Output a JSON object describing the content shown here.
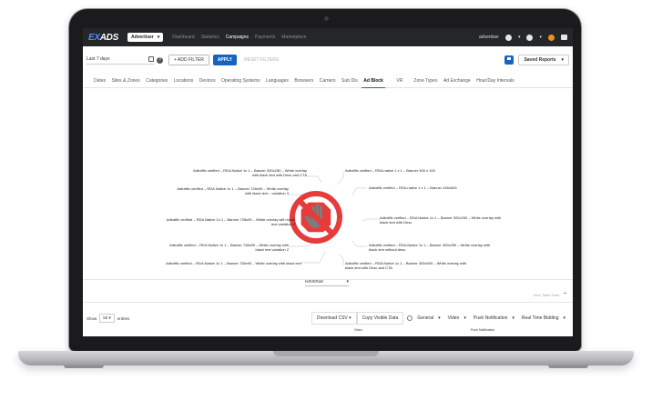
{
  "topnav": {
    "logo_prefix": "EX",
    "logo_suffix": "ADS",
    "account_select": "Advertiser",
    "links": [
      "Dashboard",
      "Statistics",
      "Campaigns",
      "Payments",
      "Marketplace"
    ],
    "active_link": "Campaigns",
    "user": "advertiser"
  },
  "filterbar": {
    "period": "Last 7 days",
    "add_filter": "+ ADD FILTER",
    "apply": "APPLY",
    "reset": "RESET FILTERS",
    "saved_reports": "Saved Reports"
  },
  "tabs": [
    "Dates",
    "Sites & Zones",
    "Categories",
    "Locations",
    "Devices",
    "Operating Systems",
    "Languages",
    "Browsers",
    "Carriers",
    "Sub IDs",
    "Ad Block",
    "VR",
    "Zone Types",
    "Ad Exchange",
    "Hour/Day Intervals"
  ],
  "active_tab": "Ad Block",
  "chart": {
    "labels_left": [
      "Adtraffic verified – RDA Native 1x 1 – Banner 300x250 – White overlay with black text with Desc and CTA",
      "Adtraffic verified – RDA Native 1x 1 – Banner 728x90 – White overlay with black text – variation 3",
      "Adtraffic verified – RDA Native 1x 1 – Banner 728x90 – White overlay with black text variation 4",
      "Adtraffic verified – RDA Native 1x 1 – Banner 728x90 – White overlay with black text variation 2",
      "Adtraffic verified – RDA Native 1x 1 – Banner 728x90 – White overlay with black text"
    ],
    "labels_right": [
      "Adtraffic verified – RDA native 1 x 1 – Banner 300 x 100",
      "Adtraffic verified – RDA native 1 x 1 – Banner 160x600",
      "Adtraffic verified – RDA Native 1x 1 – Banner 300x250 – White overlay with black text with Desc",
      "Adtraffic verified – RDA Native 1x 1 – Banner 300x250 – White overlay with black text without desc",
      "Adtraffic verified – RDA Native 1x 1 – Banner 300x500 – White overlay with black text with Desc and CTA"
    ],
    "metric": "Revenue"
  },
  "table": {
    "hide_label": "Hide Table Data",
    "show_label": "Show",
    "entries_value": "50",
    "entries_label": "entries",
    "download_csv": "Download CSV",
    "copy_visible": "Copy Visible Data",
    "general": "General",
    "video": "Video",
    "push_notification": "Push Notification",
    "real_time_bidding": "Real Time Bidding",
    "col_video": "Video",
    "col_push": "Push Notification"
  },
  "colors": {
    "accent": "#1565c0",
    "nav_bg": "#242628",
    "adblock_red": "#e63b3b",
    "adblock_hand": "#8a8a8a"
  }
}
